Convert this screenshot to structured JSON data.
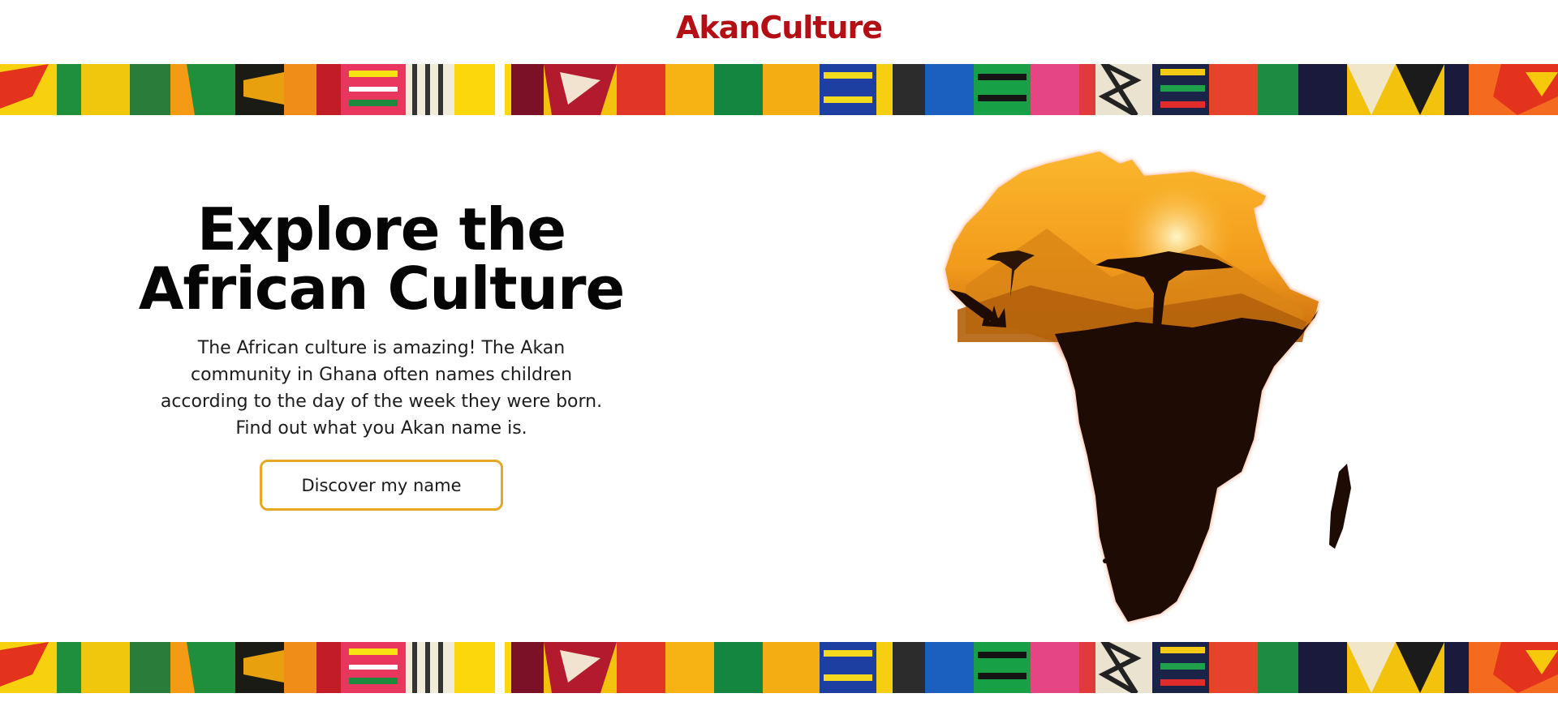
{
  "header": {
    "logo": "AkanCulture"
  },
  "hero": {
    "title_line1": "Explore the",
    "title_line2": "African Culture",
    "paragraph": "The African culture is amazing! The Akan community in Ghana often names children according to the day of the week they were born. Find out what you Akan name is.",
    "cta_label": "Discover my name"
  },
  "colors": {
    "brand": "#b30f14",
    "accent": "#e6a722",
    "text": "#050505",
    "map_sky": "#f7a928",
    "map_land": "#1e0b03"
  },
  "icons": {
    "banner": "kente-cloth-banner",
    "illustration": "africa-sunset-map"
  }
}
